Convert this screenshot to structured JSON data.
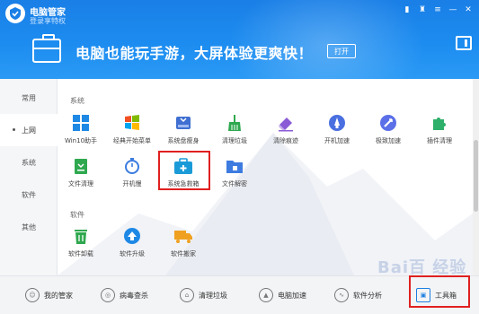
{
  "header": {
    "app_title": "电脑管家",
    "login_link": "登录享特权",
    "banner_text": "电脑也能玩手游，大屏体验更爽快！",
    "open_button": "打开"
  },
  "sidebar": {
    "items": [
      {
        "label": "常用"
      },
      {
        "label": "上网"
      },
      {
        "label": "系统"
      },
      {
        "label": "软件"
      },
      {
        "label": "其他"
      }
    ],
    "active_index": 1
  },
  "main": {
    "section_system": "系统",
    "section_software": "软件",
    "system_tools": [
      {
        "label": "Win10助手",
        "icon": "windows-icon",
        "color": "#1e88e5"
      },
      {
        "label": "经典开始菜单",
        "icon": "start-menu-icon",
        "color": "#f4a020"
      },
      {
        "label": "系统盘瘦身",
        "icon": "disk-icon",
        "color": "#3f6fd1"
      },
      {
        "label": "清理垃圾",
        "icon": "broom-icon",
        "color": "#2fa84f"
      },
      {
        "label": "清除痕迹",
        "icon": "eraser-icon",
        "color": "#8a5bd6"
      },
      {
        "label": "开机加速",
        "icon": "rocket-icon",
        "color": "#4a6fe0"
      },
      {
        "label": "极致加速",
        "icon": "speed-icon",
        "color": "#5b6fe8"
      },
      {
        "label": "插件清理",
        "icon": "puzzle-icon",
        "color": "#2eaf6a"
      },
      {
        "label": "文件清理",
        "icon": "file-clean-icon",
        "color": "#2fa84f"
      },
      {
        "label": "开机慢",
        "icon": "stopwatch-icon",
        "color": "#3a7be0"
      },
      {
        "label": "系统急救箱",
        "icon": "first-aid-kit-icon",
        "color": "#1a9bd8"
      },
      {
        "label": "文件解密",
        "icon": "folder-unlock-icon",
        "color": "#3d7be0"
      }
    ],
    "software_tools": [
      {
        "label": "软件卸载",
        "icon": "trash-icon",
        "color": "#2fa84f"
      },
      {
        "label": "软件升级",
        "icon": "upgrade-icon",
        "color": "#1e88e5"
      },
      {
        "label": "软件搬家",
        "icon": "truck-icon",
        "color": "#f0a020"
      }
    ]
  },
  "bottombar": {
    "items": [
      {
        "label": "我的管家",
        "icon": "user-icon"
      },
      {
        "label": "病毒查杀",
        "icon": "virus-scan-icon"
      },
      {
        "label": "清理垃圾",
        "icon": "clean-icon"
      },
      {
        "label": "电脑加速",
        "icon": "rocket-icon"
      },
      {
        "label": "软件分析",
        "icon": "analysis-icon"
      },
      {
        "label": "工具箱",
        "icon": "toolbox-icon"
      }
    ]
  },
  "watermark": "Bai百 经验"
}
